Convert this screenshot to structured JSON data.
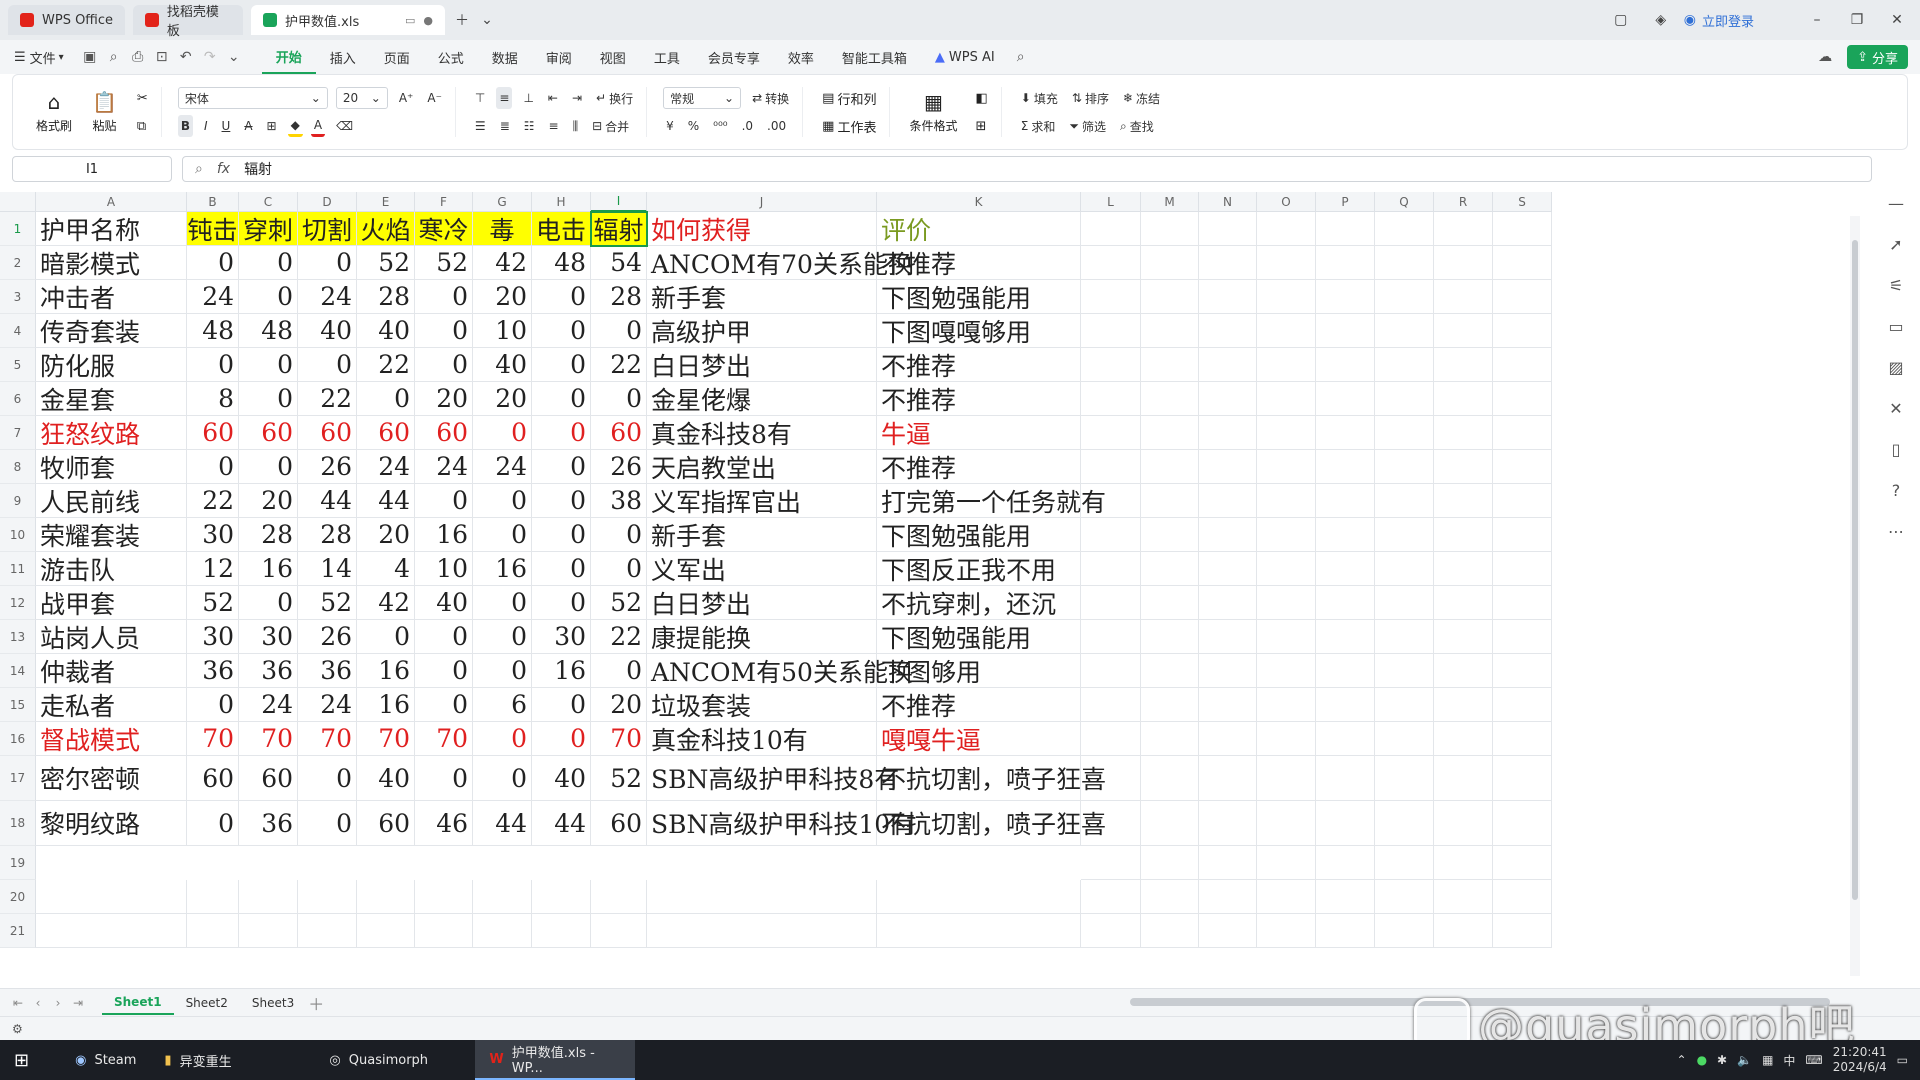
{
  "titlebar": {
    "tabs": [
      {
        "label": "WPS Office",
        "color": "#e2231a"
      },
      {
        "label": "找稻壳模板",
        "color": "#e2231a"
      },
      {
        "label": "护甲数值.xls",
        "color": "#1aa45a"
      }
    ],
    "login_label": "立即登录"
  },
  "menubar": {
    "file_label": "文件",
    "items": [
      "开始",
      "插入",
      "页面",
      "公式",
      "数据",
      "审阅",
      "视图",
      "工具",
      "会员专享",
      "效率",
      "智能工具箱"
    ],
    "active_item": "开始",
    "wps_ai_label": "WPS AI",
    "share_label": "分享"
  },
  "ribbon": {
    "format_painter": "格式刷",
    "paste": "粘贴",
    "font_name": "宋体",
    "font_size": "20",
    "wrap_label": "换行",
    "merge_label": "合并",
    "number_format": "常规",
    "convert_label": "转换",
    "rowcol_label": "行和列",
    "sheet_label": "工作表",
    "cond_format_label": "条件格式",
    "fill_label": "填充",
    "sort_label": "排序",
    "freeze_label": "冻结",
    "sum_label": "求和",
    "filter_label": "筛选",
    "find_label": "查找"
  },
  "formula_bar": {
    "cell_ref": "I1",
    "fx_label": "fx",
    "content": "辐射"
  },
  "columns": [
    "A",
    "B",
    "C",
    "D",
    "E",
    "F",
    "G",
    "H",
    "I",
    "J",
    "K",
    "L",
    "M",
    "N",
    "O",
    "P",
    "Q",
    "R",
    "S"
  ],
  "sheet": {
    "header": [
      "护甲名称",
      "钝击",
      "穿刺",
      "切割",
      "火焰",
      "寒冷",
      "毒",
      "电击",
      "辐射",
      "如何获得",
      "评价"
    ],
    "rows": [
      {
        "name": "暗影模式",
        "values": [
          0,
          0,
          0,
          52,
          52,
          42,
          48,
          54
        ],
        "source": "ANCOM有70关系能换",
        "rating": "不推荐",
        "highlight": false
      },
      {
        "name": "冲击者",
        "values": [
          24,
          0,
          24,
          28,
          0,
          20,
          0,
          28
        ],
        "source": "新手套",
        "rating": "下图勉强能用",
        "highlight": false
      },
      {
        "name": "传奇套装",
        "values": [
          48,
          48,
          40,
          40,
          0,
          10,
          0,
          0
        ],
        "source": "高级护甲",
        "rating": "下图嘎嘎够用",
        "highlight": false
      },
      {
        "name": "防化服",
        "values": [
          0,
          0,
          0,
          22,
          0,
          40,
          0,
          22
        ],
        "source": "白日梦出",
        "rating": "不推荐",
        "highlight": false
      },
      {
        "name": "金星套",
        "values": [
          8,
          0,
          22,
          0,
          20,
          20,
          0,
          0
        ],
        "source": "金星佬爆",
        "rating": "不推荐",
        "highlight": false
      },
      {
        "name": "狂怒纹路",
        "values": [
          60,
          60,
          60,
          60,
          60,
          0,
          0,
          60
        ],
        "source": "真金科技8有",
        "rating": "牛逼",
        "highlight": true
      },
      {
        "name": "牧师套",
        "values": [
          0,
          0,
          26,
          24,
          24,
          24,
          0,
          26
        ],
        "source": "天启教堂出",
        "rating": "不推荐",
        "highlight": false
      },
      {
        "name": "人民前线",
        "values": [
          22,
          20,
          44,
          44,
          0,
          0,
          0,
          38
        ],
        "source": "义军指挥官出",
        "rating": "打完第一个任务就有",
        "highlight": false
      },
      {
        "name": "荣耀套装",
        "values": [
          30,
          28,
          28,
          20,
          16,
          0,
          0,
          0
        ],
        "source": "新手套",
        "rating": "下图勉强能用",
        "highlight": false
      },
      {
        "name": "游击队",
        "values": [
          12,
          16,
          14,
          4,
          10,
          16,
          0,
          0
        ],
        "source": "义军出",
        "rating": "下图反正我不用",
        "highlight": false
      },
      {
        "name": "战甲套",
        "values": [
          52,
          0,
          52,
          42,
          40,
          0,
          0,
          52
        ],
        "source": "白日梦出",
        "rating": "不抗穿刺，还沉",
        "highlight": false
      },
      {
        "name": "站岗人员",
        "values": [
          30,
          30,
          26,
          0,
          0,
          0,
          30,
          22
        ],
        "source": "康提能换",
        "rating": "下图勉强能用",
        "highlight": false
      },
      {
        "name": "仲裁者",
        "values": [
          36,
          36,
          36,
          16,
          0,
          0,
          16,
          0
        ],
        "source": "ANCOM有50关系能换",
        "rating": "下图够用",
        "highlight": false
      },
      {
        "name": "走私者",
        "values": [
          0,
          24,
          24,
          16,
          0,
          6,
          0,
          20
        ],
        "source": "垃圾套装",
        "rating": "不推荐",
        "highlight": false
      },
      {
        "name": "督战模式",
        "values": [
          70,
          70,
          70,
          70,
          70,
          0,
          0,
          70
        ],
        "source": "真金科技10有",
        "rating": "嘎嘎牛逼",
        "highlight": true
      },
      {
        "name": "密尔密顿",
        "values": [
          60,
          60,
          0,
          40,
          0,
          0,
          40,
          52
        ],
        "source": "SBN高级护甲科技8有",
        "rating": "不抗切割，喷子狂喜",
        "highlight": false
      },
      {
        "name": "黎明纹路",
        "values": [
          0,
          36,
          0,
          60,
          46,
          44,
          44,
          60
        ],
        "source": "SBN高级护甲科技10有",
        "rating": "不抗切割，喷子狂喜",
        "highlight": false
      }
    ],
    "empty_row_numbers": [
      19,
      20,
      21
    ]
  },
  "sheet_tabs": [
    "Sheet1",
    "Sheet2",
    "Sheet3"
  ],
  "active_sheet": "Sheet1",
  "taskbar": {
    "items": [
      "Steam",
      "异变重生",
      "Quasimorph",
      "护甲数值.xls - WP..."
    ],
    "time": "21:20:41",
    "date": "2024/6/4",
    "ime": "中"
  },
  "watermark": "@quasimorph吧",
  "colors": {
    "accent": "#1aa45a",
    "header_fill": "#ffff00",
    "red": "#e02020",
    "rating_header": "#7a9a20"
  }
}
